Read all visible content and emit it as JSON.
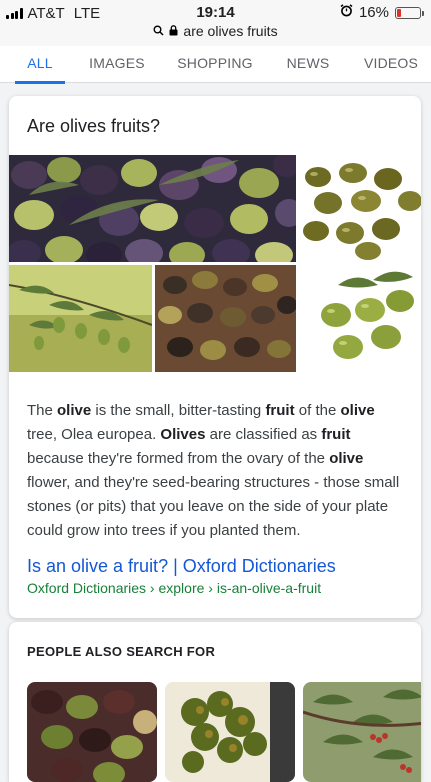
{
  "status_bar": {
    "carrier": "AT&T",
    "network": "LTE",
    "time": "19:14",
    "url": "are olives fruits",
    "battery": "16%",
    "battery_level": 0.16
  },
  "tabs": [
    {
      "label": "ALL",
      "active": true
    },
    {
      "label": "IMAGES",
      "active": false
    },
    {
      "label": "SHOPPING",
      "active": false
    },
    {
      "label": "NEWS",
      "active": false
    },
    {
      "label": "VIDEOS",
      "active": false
    }
  ],
  "answer": {
    "question": "Are olives fruits?",
    "description_parts": [
      {
        "t": "The ",
        "b": false
      },
      {
        "t": "olive",
        "b": true
      },
      {
        "t": " is the small, bitter-tasting ",
        "b": false
      },
      {
        "t": "fruit",
        "b": true
      },
      {
        "t": " of the ",
        "b": false
      },
      {
        "t": "olive",
        "b": true
      },
      {
        "t": " tree, Olea europea. ",
        "b": false
      },
      {
        "t": "Olives",
        "b": true
      },
      {
        "t": " are classified as ",
        "b": false
      },
      {
        "t": "fruit",
        "b": true
      },
      {
        "t": " because they're formed from the ovary of the ",
        "b": false
      },
      {
        "t": "olive",
        "b": true
      },
      {
        "t": " flower, and they're seed-bearing structures - those small stones (or pits) that you leave on the side of your plate could grow into trees if you planted them.",
        "b": false
      }
    ],
    "source_title": "Is an olive a fruit? | Oxford Dictionaries",
    "source_url": "Oxford Dictionaries › explore › is-an-olive-a-fruit"
  },
  "people_also_search": {
    "header": "PEOPLE ALSO SEARCH FOR"
  },
  "colors": {
    "accent": "#1a73e8",
    "link": "#1558d6",
    "url_green": "#188038",
    "battery_red": "#e0312b"
  }
}
